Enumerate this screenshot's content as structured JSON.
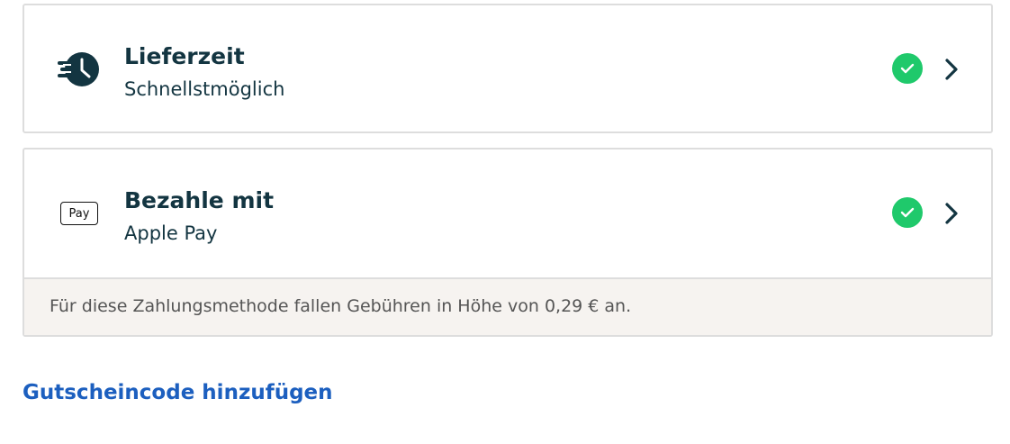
{
  "delivery": {
    "title": "Lieferzeit",
    "value": "Schnellstmöglich",
    "icon": "clock-fast-icon",
    "status_icon": "check-circle-icon"
  },
  "payment": {
    "title": "Bezahle mit",
    "value": "Apple Pay",
    "icon": "apple-pay-icon",
    "icon_apple_glyph": "",
    "icon_label": "Pay",
    "status_icon": "check-circle-icon",
    "fee_notice": "Für diese Zahlungsmethode fallen Gebühren in Höhe von 0,29 € an."
  },
  "voucher": {
    "label": "Gutscheincode hinzufügen"
  },
  "colors": {
    "text_dark": "#133541",
    "success_green": "#1fc96b",
    "link_blue": "#1c5fbf",
    "notice_bg": "#f6f3f0",
    "border": "#dddddd"
  }
}
